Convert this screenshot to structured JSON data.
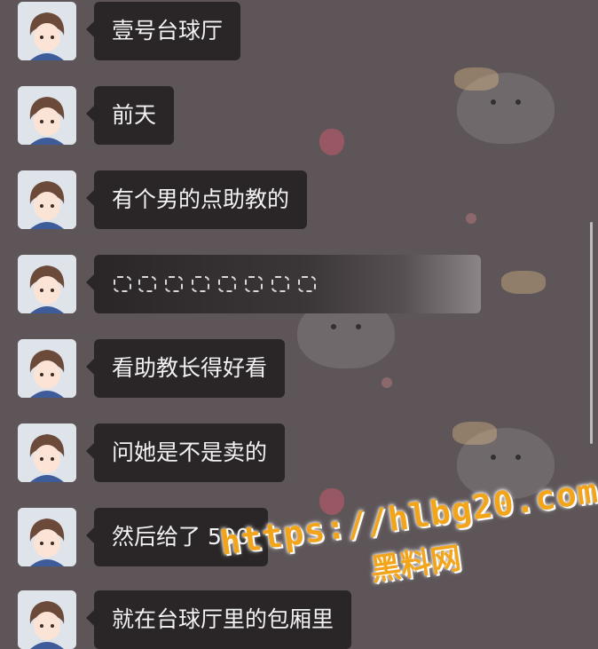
{
  "chat": {
    "messages": [
      {
        "text": "壹号台球厅"
      },
      {
        "text": "前天"
      },
      {
        "text": "有个男的点助教的"
      },
      {
        "text": ""
      },
      {
        "text": "看助教长得好看"
      },
      {
        "text": "问她是不是卖的"
      },
      {
        "text": "然后给了 500"
      },
      {
        "text": "就在台球厅里的包厢里"
      }
    ]
  },
  "watermark": {
    "url": "https://hlbg20.com",
    "site_name": "黑料网"
  },
  "colors": {
    "background": "#5d5558",
    "bubble": "#2a2627",
    "bubble_text": "#f2f2f2",
    "watermark": "#f2a41b"
  }
}
